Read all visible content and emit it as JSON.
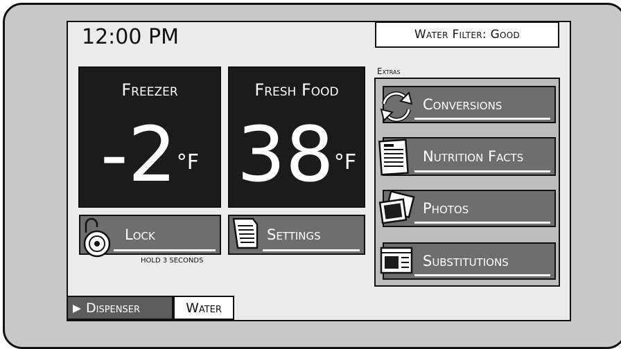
{
  "header": {
    "clock": "12:00 PM",
    "filter_status": "Water Filter: Good"
  },
  "freezer": {
    "label": "Freezer",
    "temp": "-2",
    "unit": "°F"
  },
  "fresh_food": {
    "label": "Fresh Food",
    "temp": "38",
    "unit": "°F"
  },
  "controls": {
    "lock_label": "Lock",
    "lock_hint": "HOLD 3 SECONDS",
    "settings_label": "Settings"
  },
  "extras": {
    "title": "Extras",
    "items": [
      {
        "label": "Conversions",
        "icon": "conversions-icon"
      },
      {
        "label": "Nutrition Facts",
        "icon": "nutrition-facts-icon"
      },
      {
        "label": "Photos",
        "icon": "photos-icon"
      },
      {
        "label": "Substitutions",
        "icon": "substitutions-icon"
      }
    ]
  },
  "footer": {
    "dispenser_label": "Dispenser",
    "water_label": "Water"
  },
  "colors": {
    "panel": "#1b1b1b",
    "button": "#6e6e6e",
    "bezel": "#c8c8c8",
    "screen": "#ececec"
  }
}
